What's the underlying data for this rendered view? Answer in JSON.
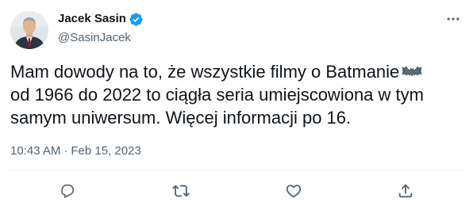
{
  "author": {
    "display_name": "Jacek Sasin",
    "handle": "@SasinJacek",
    "verified": true
  },
  "tweet": {
    "text": "Mam dowody na to, że wszystkie filmy o Batmanie",
    "text_rest": "od 1966 do 2022 to ciągła seria umiejscowiona w tym samym uniwersum. Więcej informacji po 16.",
    "emoji": "bat-icon",
    "time": "10:43 AM",
    "separator": "·",
    "date": "Feb 15, 2023"
  },
  "actions": [
    {
      "name": "reply",
      "icon": "reply-icon"
    },
    {
      "name": "retweet",
      "icon": "retweet-icon"
    },
    {
      "name": "like",
      "icon": "heart-icon"
    },
    {
      "name": "share",
      "icon": "share-icon"
    }
  ],
  "colors": {
    "text_primary": "#0f1419",
    "text_secondary": "#536471",
    "verified_blue": "#1d9bf0",
    "divider": "#eff3f4"
  }
}
